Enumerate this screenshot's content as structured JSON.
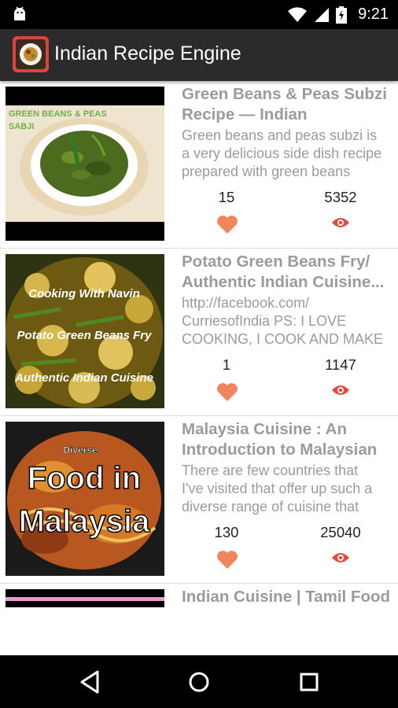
{
  "status_bar": {
    "time": "9:21",
    "icons": [
      "android-icon",
      "wifi-icon",
      "signal-icon",
      "battery-charging-icon"
    ]
  },
  "app_bar": {
    "title": "Indian Recipe Engine",
    "logo_icon": "recipe-logo-icon",
    "background": "#2b2b2b"
  },
  "recipes": [
    {
      "title": "Green Beans & Peas Subzi Recipe — Indian",
      "title_line1": "Green Beans & Peas Subzi",
      "title_line2": "Recipe — Indian",
      "desc_line1": "Green beans and peas subzi is",
      "desc_line2": "a very delicious side dish recipe",
      "desc_line3": "prepared with green beans",
      "likes": "15",
      "views": "5352",
      "thumb_text": [
        "GREEN BEANS & PEAS",
        "SABJI"
      ]
    },
    {
      "title_line1": "Potato Green Beans Fry/",
      "title_line2": "Authentic Indian Cuisine...",
      "desc_line1": "http://facebook.com/",
      "desc_line2": "CurriesofIndia PS: I LOVE",
      "desc_line3": "COOKING, I COOK AND MAKE",
      "likes": "1",
      "views": "1147",
      "thumb_text": [
        "Cooking With Navin",
        "Potato Green Beans Fry",
        "Authentic Indian Cuisine"
      ]
    },
    {
      "title_line1": "Malaysia Cuisine : An",
      "title_line2": "Introduction to Malaysian",
      "desc_line1": "There are few countries that",
      "desc_line2": "I've visited that offer up such a",
      "desc_line3": "diverse range of cuisine that",
      "likes": "130",
      "views": "25040",
      "thumb_text": [
        "Diverse",
        "Food in",
        "Malaysia"
      ]
    },
    {
      "title_line1": "Indian Cuisine | Tamil Food"
    }
  ],
  "colors": {
    "heart": "#f0855e",
    "eye": "#e8483f",
    "title_text": "#9b9b9b"
  },
  "nav_bar": {
    "icons": [
      "back-icon",
      "home-icon",
      "recents-icon"
    ]
  }
}
